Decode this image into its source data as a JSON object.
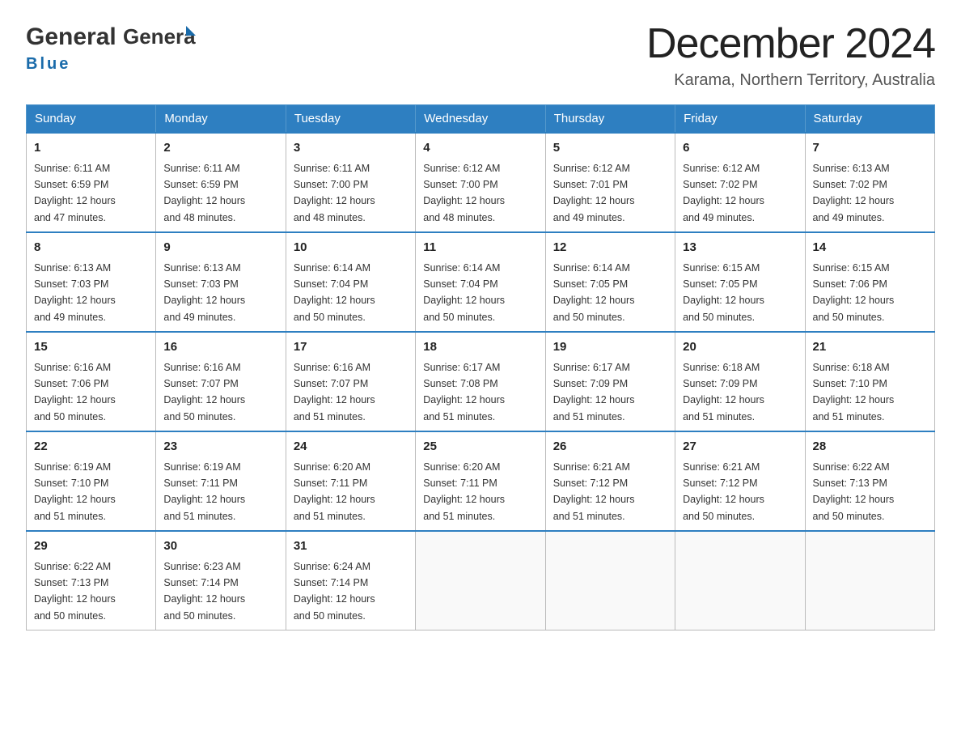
{
  "header": {
    "logo_general": "General",
    "logo_blue": "Blue",
    "month_title": "December 2024",
    "location": "Karama, Northern Territory, Australia"
  },
  "days_of_week": [
    "Sunday",
    "Monday",
    "Tuesday",
    "Wednesday",
    "Thursday",
    "Friday",
    "Saturday"
  ],
  "weeks": [
    [
      {
        "day": "1",
        "sunrise": "6:11 AM",
        "sunset": "6:59 PM",
        "daylight": "12 hours and 47 minutes."
      },
      {
        "day": "2",
        "sunrise": "6:11 AM",
        "sunset": "6:59 PM",
        "daylight": "12 hours and 48 minutes."
      },
      {
        "day": "3",
        "sunrise": "6:11 AM",
        "sunset": "7:00 PM",
        "daylight": "12 hours and 48 minutes."
      },
      {
        "day": "4",
        "sunrise": "6:12 AM",
        "sunset": "7:00 PM",
        "daylight": "12 hours and 48 minutes."
      },
      {
        "day": "5",
        "sunrise": "6:12 AM",
        "sunset": "7:01 PM",
        "daylight": "12 hours and 49 minutes."
      },
      {
        "day": "6",
        "sunrise": "6:12 AM",
        "sunset": "7:02 PM",
        "daylight": "12 hours and 49 minutes."
      },
      {
        "day": "7",
        "sunrise": "6:13 AM",
        "sunset": "7:02 PM",
        "daylight": "12 hours and 49 minutes."
      }
    ],
    [
      {
        "day": "8",
        "sunrise": "6:13 AM",
        "sunset": "7:03 PM",
        "daylight": "12 hours and 49 minutes."
      },
      {
        "day": "9",
        "sunrise": "6:13 AM",
        "sunset": "7:03 PM",
        "daylight": "12 hours and 49 minutes."
      },
      {
        "day": "10",
        "sunrise": "6:14 AM",
        "sunset": "7:04 PM",
        "daylight": "12 hours and 50 minutes."
      },
      {
        "day": "11",
        "sunrise": "6:14 AM",
        "sunset": "7:04 PM",
        "daylight": "12 hours and 50 minutes."
      },
      {
        "day": "12",
        "sunrise": "6:14 AM",
        "sunset": "7:05 PM",
        "daylight": "12 hours and 50 minutes."
      },
      {
        "day": "13",
        "sunrise": "6:15 AM",
        "sunset": "7:05 PM",
        "daylight": "12 hours and 50 minutes."
      },
      {
        "day": "14",
        "sunrise": "6:15 AM",
        "sunset": "7:06 PM",
        "daylight": "12 hours and 50 minutes."
      }
    ],
    [
      {
        "day": "15",
        "sunrise": "6:16 AM",
        "sunset": "7:06 PM",
        "daylight": "12 hours and 50 minutes."
      },
      {
        "day": "16",
        "sunrise": "6:16 AM",
        "sunset": "7:07 PM",
        "daylight": "12 hours and 50 minutes."
      },
      {
        "day": "17",
        "sunrise": "6:16 AM",
        "sunset": "7:07 PM",
        "daylight": "12 hours and 51 minutes."
      },
      {
        "day": "18",
        "sunrise": "6:17 AM",
        "sunset": "7:08 PM",
        "daylight": "12 hours and 51 minutes."
      },
      {
        "day": "19",
        "sunrise": "6:17 AM",
        "sunset": "7:09 PM",
        "daylight": "12 hours and 51 minutes."
      },
      {
        "day": "20",
        "sunrise": "6:18 AM",
        "sunset": "7:09 PM",
        "daylight": "12 hours and 51 minutes."
      },
      {
        "day": "21",
        "sunrise": "6:18 AM",
        "sunset": "7:10 PM",
        "daylight": "12 hours and 51 minutes."
      }
    ],
    [
      {
        "day": "22",
        "sunrise": "6:19 AM",
        "sunset": "7:10 PM",
        "daylight": "12 hours and 51 minutes."
      },
      {
        "day": "23",
        "sunrise": "6:19 AM",
        "sunset": "7:11 PM",
        "daylight": "12 hours and 51 minutes."
      },
      {
        "day": "24",
        "sunrise": "6:20 AM",
        "sunset": "7:11 PM",
        "daylight": "12 hours and 51 minutes."
      },
      {
        "day": "25",
        "sunrise": "6:20 AM",
        "sunset": "7:11 PM",
        "daylight": "12 hours and 51 minutes."
      },
      {
        "day": "26",
        "sunrise": "6:21 AM",
        "sunset": "7:12 PM",
        "daylight": "12 hours and 51 minutes."
      },
      {
        "day": "27",
        "sunrise": "6:21 AM",
        "sunset": "7:12 PM",
        "daylight": "12 hours and 50 minutes."
      },
      {
        "day": "28",
        "sunrise": "6:22 AM",
        "sunset": "7:13 PM",
        "daylight": "12 hours and 50 minutes."
      }
    ],
    [
      {
        "day": "29",
        "sunrise": "6:22 AM",
        "sunset": "7:13 PM",
        "daylight": "12 hours and 50 minutes."
      },
      {
        "day": "30",
        "sunrise": "6:23 AM",
        "sunset": "7:14 PM",
        "daylight": "12 hours and 50 minutes."
      },
      {
        "day": "31",
        "sunrise": "6:24 AM",
        "sunset": "7:14 PM",
        "daylight": "12 hours and 50 minutes."
      },
      null,
      null,
      null,
      null
    ]
  ],
  "labels": {
    "sunrise": "Sunrise:",
    "sunset": "Sunset:",
    "daylight": "Daylight:"
  }
}
